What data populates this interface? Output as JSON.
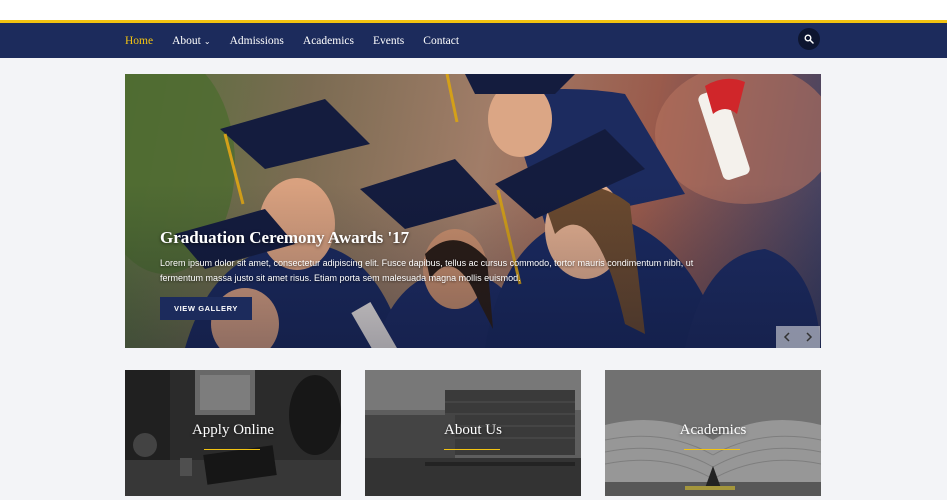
{
  "nav": {
    "items": [
      {
        "label": "Home",
        "active": true
      },
      {
        "label": "About",
        "dropdown": true
      },
      {
        "label": "Admissions"
      },
      {
        "label": "Academics"
      },
      {
        "label": "Events"
      },
      {
        "label": "Contact"
      }
    ],
    "search_icon": "search-icon"
  },
  "hero": {
    "title": "Graduation Ceremony Awards '17",
    "text": "Lorem ipsum dolor sit amet, consectetur adipiscing elit. Fusce dapibus, tellus ac cursus commodo, tortor mauris condimentum nibh, ut fermentum massa justo sit amet risus. Etiam porta sem malesuada magna mollis euismod.",
    "button": "VIEW GALLERY",
    "prev_icon": "chevron-left-icon",
    "next_icon": "chevron-right-icon"
  },
  "cards": [
    {
      "title": "Apply Online"
    },
    {
      "title": "About Us"
    },
    {
      "title": "Academics"
    }
  ],
  "colors": {
    "navy": "#1c2b5c",
    "gold": "#f2c312",
    "background": "#f3f4f7"
  }
}
